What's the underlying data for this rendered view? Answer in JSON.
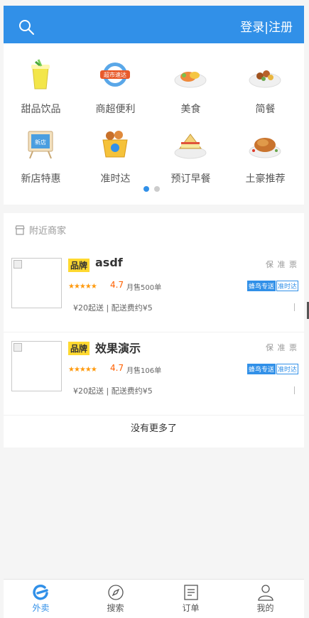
{
  "header": {
    "auth_label": "登录|注册"
  },
  "categories": [
    {
      "label": "甜品饮品",
      "icon": "drink-icon"
    },
    {
      "label": "商超便利",
      "icon": "supermarket-icon",
      "badge": "超市速达"
    },
    {
      "label": "美食",
      "icon": "food-plate-icon"
    },
    {
      "label": "简餐",
      "icon": "simple-meal-icon"
    },
    {
      "label": "新店特惠",
      "icon": "new-store-icon",
      "badge": "新店"
    },
    {
      "label": "准时达",
      "icon": "on-time-icon"
    },
    {
      "label": "预订早餐",
      "icon": "breakfast-icon"
    },
    {
      "label": "土豪推荐",
      "icon": "roast-chicken-icon"
    }
  ],
  "carousel": {
    "active_index": 0,
    "count": 2
  },
  "nearby": {
    "title": "附近商家"
  },
  "shops": [
    {
      "brand": "品牌",
      "name": "asdf",
      "guarantees": "保 准 票",
      "rating": "4.7",
      "sales": "月售500单",
      "delivery_tag": "蜂鸟专送",
      "ontime_tag": "准时达",
      "fee": "¥20起送 | 配送费约¥5"
    },
    {
      "brand": "品牌",
      "name": "效果演示",
      "guarantees": "保 准 票",
      "rating": "4.7",
      "sales": "月售106单",
      "delivery_tag": "蜂鸟专送",
      "ontime_tag": "准时达",
      "fee": "¥20起送 | 配送费约¥5"
    }
  ],
  "no_more": "没有更多了",
  "tabs": [
    {
      "label": "外卖",
      "icon": "eleme-icon",
      "active": true
    },
    {
      "label": "搜索",
      "icon": "compass-icon",
      "active": false
    },
    {
      "label": "订单",
      "icon": "order-icon",
      "active": false
    },
    {
      "label": "我的",
      "icon": "user-icon",
      "active": false
    }
  ],
  "colors": {
    "primary": "#3190e8",
    "star": "#ff9a0d",
    "rating": "#ff6000",
    "brand_tag": "#ffd930"
  }
}
